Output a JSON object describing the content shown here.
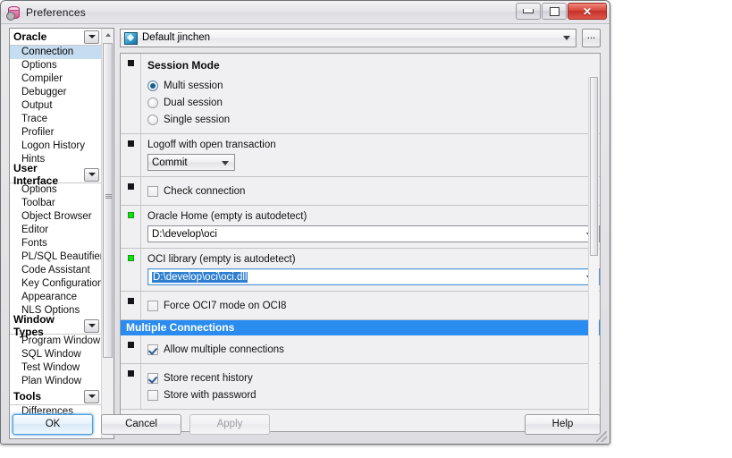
{
  "window": {
    "title": "Preferences",
    "icon": "database-gear-icon",
    "controls": {
      "minimize": "minimize-icon",
      "maximize": "maximize-icon",
      "close": "close-icon"
    }
  },
  "sidebar": {
    "groups": [
      {
        "label": "Oracle",
        "expanded": true,
        "items": [
          {
            "label": "Connection",
            "selected": true
          },
          {
            "label": "Options",
            "selected": false
          },
          {
            "label": "Compiler",
            "selected": false
          },
          {
            "label": "Debugger",
            "selected": false
          },
          {
            "label": "Output",
            "selected": false
          },
          {
            "label": "Trace",
            "selected": false
          },
          {
            "label": "Profiler",
            "selected": false
          },
          {
            "label": "Logon History",
            "selected": false
          },
          {
            "label": "Hints",
            "selected": false
          }
        ]
      },
      {
        "label": "User Interface",
        "expanded": true,
        "items": [
          {
            "label": "Options",
            "selected": false
          },
          {
            "label": "Toolbar",
            "selected": false
          },
          {
            "label": "Object Browser",
            "selected": false
          },
          {
            "label": "Editor",
            "selected": false
          },
          {
            "label": "Fonts",
            "selected": false
          },
          {
            "label": "PL/SQL Beautifier",
            "selected": false
          },
          {
            "label": "Code Assistant",
            "selected": false
          },
          {
            "label": "Key Configuration",
            "selected": false
          },
          {
            "label": "Appearance",
            "selected": false
          },
          {
            "label": "NLS Options",
            "selected": false
          }
        ]
      },
      {
        "label": "Window Types",
        "expanded": true,
        "items": [
          {
            "label": "Program Window",
            "selected": false
          },
          {
            "label": "SQL Window",
            "selected": false
          },
          {
            "label": "Test Window",
            "selected": false
          },
          {
            "label": "Plan Window",
            "selected": false
          }
        ]
      },
      {
        "label": "Tools",
        "expanded": true,
        "items": [
          {
            "label": "Differences",
            "selected": false
          }
        ]
      }
    ]
  },
  "profile": {
    "value": "Default jinchen",
    "icon": "user-profile-icon",
    "more_button": "..."
  },
  "options": {
    "session_mode": {
      "title": "Session Mode",
      "marker": "black",
      "radios": [
        {
          "label": "Multi session",
          "checked": true
        },
        {
          "label": "Dual session",
          "checked": false
        },
        {
          "label": "Single session",
          "checked": false
        }
      ]
    },
    "logoff": {
      "label": "Logoff with open transaction",
      "marker": "black",
      "value": "Commit"
    },
    "check_connection": {
      "label": "Check connection",
      "marker": "black",
      "checked": false
    },
    "oracle_home": {
      "label": "Oracle Home (empty is autodetect)",
      "marker": "green",
      "value": "D:\\develop\\oci"
    },
    "oci_library": {
      "label": "OCI library (empty is autodetect)",
      "marker": "green",
      "value": "D:\\develop\\oci\\oci.dll",
      "selected": true,
      "focused": true
    },
    "force_oci7": {
      "label": "Force OCI7 mode on OCI8",
      "marker": "black",
      "checked": false
    },
    "multiple_connections_header": "Multiple Connections",
    "allow_multiple": {
      "label": "Allow multiple connections",
      "marker": "black",
      "checked": true
    },
    "history": {
      "marker": "black",
      "store_recent": {
        "label": "Store recent history",
        "checked": true
      },
      "store_password": {
        "label": "Store with password",
        "checked": false
      }
    }
  },
  "footer": {
    "ok": "OK",
    "cancel": "Cancel",
    "apply": "Apply",
    "help": "Help"
  },
  "colors": {
    "accent": "#2b8cf0",
    "selection": "#2f7fd1",
    "tree_selection": "#c6dcf0",
    "marker_changed": "#12e012",
    "close_button": "#d9463a"
  }
}
